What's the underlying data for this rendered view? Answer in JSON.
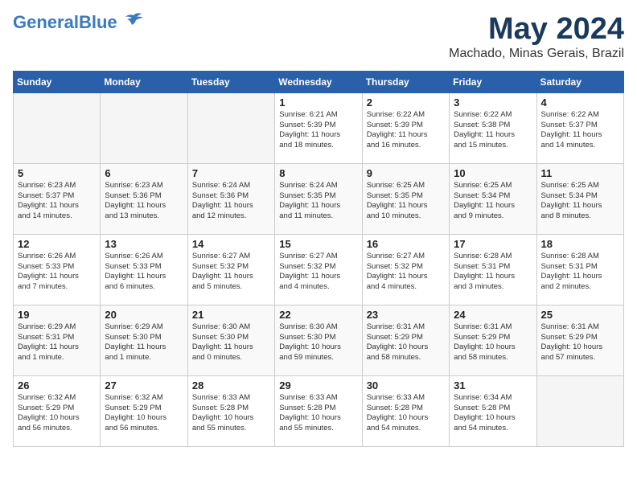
{
  "header": {
    "logo_line1": "General",
    "logo_line2": "Blue",
    "title": "May 2024",
    "subtitle": "Machado, Minas Gerais, Brazil"
  },
  "columns": [
    "Sunday",
    "Monday",
    "Tuesday",
    "Wednesday",
    "Thursday",
    "Friday",
    "Saturday"
  ],
  "weeks": [
    [
      {
        "num": "",
        "info": "",
        "empty": true
      },
      {
        "num": "",
        "info": "",
        "empty": true
      },
      {
        "num": "",
        "info": "",
        "empty": true
      },
      {
        "num": "1",
        "info": "Sunrise: 6:21 AM\nSunset: 5:39 PM\nDaylight: 11 hours\nand 18 minutes."
      },
      {
        "num": "2",
        "info": "Sunrise: 6:22 AM\nSunset: 5:39 PM\nDaylight: 11 hours\nand 16 minutes."
      },
      {
        "num": "3",
        "info": "Sunrise: 6:22 AM\nSunset: 5:38 PM\nDaylight: 11 hours\nand 15 minutes."
      },
      {
        "num": "4",
        "info": "Sunrise: 6:22 AM\nSunset: 5:37 PM\nDaylight: 11 hours\nand 14 minutes."
      }
    ],
    [
      {
        "num": "5",
        "info": "Sunrise: 6:23 AM\nSunset: 5:37 PM\nDaylight: 11 hours\nand 14 minutes."
      },
      {
        "num": "6",
        "info": "Sunrise: 6:23 AM\nSunset: 5:36 PM\nDaylight: 11 hours\nand 13 minutes."
      },
      {
        "num": "7",
        "info": "Sunrise: 6:24 AM\nSunset: 5:36 PM\nDaylight: 11 hours\nand 12 minutes."
      },
      {
        "num": "8",
        "info": "Sunrise: 6:24 AM\nSunset: 5:35 PM\nDaylight: 11 hours\nand 11 minutes."
      },
      {
        "num": "9",
        "info": "Sunrise: 6:25 AM\nSunset: 5:35 PM\nDaylight: 11 hours\nand 10 minutes."
      },
      {
        "num": "10",
        "info": "Sunrise: 6:25 AM\nSunset: 5:34 PM\nDaylight: 11 hours\nand 9 minutes."
      },
      {
        "num": "11",
        "info": "Sunrise: 6:25 AM\nSunset: 5:34 PM\nDaylight: 11 hours\nand 8 minutes."
      }
    ],
    [
      {
        "num": "12",
        "info": "Sunrise: 6:26 AM\nSunset: 5:33 PM\nDaylight: 11 hours\nand 7 minutes."
      },
      {
        "num": "13",
        "info": "Sunrise: 6:26 AM\nSunset: 5:33 PM\nDaylight: 11 hours\nand 6 minutes."
      },
      {
        "num": "14",
        "info": "Sunrise: 6:27 AM\nSunset: 5:32 PM\nDaylight: 11 hours\nand 5 minutes."
      },
      {
        "num": "15",
        "info": "Sunrise: 6:27 AM\nSunset: 5:32 PM\nDaylight: 11 hours\nand 4 minutes."
      },
      {
        "num": "16",
        "info": "Sunrise: 6:27 AM\nSunset: 5:32 PM\nDaylight: 11 hours\nand 4 minutes."
      },
      {
        "num": "17",
        "info": "Sunrise: 6:28 AM\nSunset: 5:31 PM\nDaylight: 11 hours\nand 3 minutes."
      },
      {
        "num": "18",
        "info": "Sunrise: 6:28 AM\nSunset: 5:31 PM\nDaylight: 11 hours\nand 2 minutes."
      }
    ],
    [
      {
        "num": "19",
        "info": "Sunrise: 6:29 AM\nSunset: 5:31 PM\nDaylight: 11 hours\nand 1 minute."
      },
      {
        "num": "20",
        "info": "Sunrise: 6:29 AM\nSunset: 5:30 PM\nDaylight: 11 hours\nand 1 minute."
      },
      {
        "num": "21",
        "info": "Sunrise: 6:30 AM\nSunset: 5:30 PM\nDaylight: 11 hours\nand 0 minutes."
      },
      {
        "num": "22",
        "info": "Sunrise: 6:30 AM\nSunset: 5:30 PM\nDaylight: 10 hours\nand 59 minutes."
      },
      {
        "num": "23",
        "info": "Sunrise: 6:31 AM\nSunset: 5:29 PM\nDaylight: 10 hours\nand 58 minutes."
      },
      {
        "num": "24",
        "info": "Sunrise: 6:31 AM\nSunset: 5:29 PM\nDaylight: 10 hours\nand 58 minutes."
      },
      {
        "num": "25",
        "info": "Sunrise: 6:31 AM\nSunset: 5:29 PM\nDaylight: 10 hours\nand 57 minutes."
      }
    ],
    [
      {
        "num": "26",
        "info": "Sunrise: 6:32 AM\nSunset: 5:29 PM\nDaylight: 10 hours\nand 56 minutes."
      },
      {
        "num": "27",
        "info": "Sunrise: 6:32 AM\nSunset: 5:29 PM\nDaylight: 10 hours\nand 56 minutes."
      },
      {
        "num": "28",
        "info": "Sunrise: 6:33 AM\nSunset: 5:28 PM\nDaylight: 10 hours\nand 55 minutes."
      },
      {
        "num": "29",
        "info": "Sunrise: 6:33 AM\nSunset: 5:28 PM\nDaylight: 10 hours\nand 55 minutes."
      },
      {
        "num": "30",
        "info": "Sunrise: 6:33 AM\nSunset: 5:28 PM\nDaylight: 10 hours\nand 54 minutes."
      },
      {
        "num": "31",
        "info": "Sunrise: 6:34 AM\nSunset: 5:28 PM\nDaylight: 10 hours\nand 54 minutes."
      },
      {
        "num": "",
        "info": "",
        "empty": true
      }
    ]
  ]
}
